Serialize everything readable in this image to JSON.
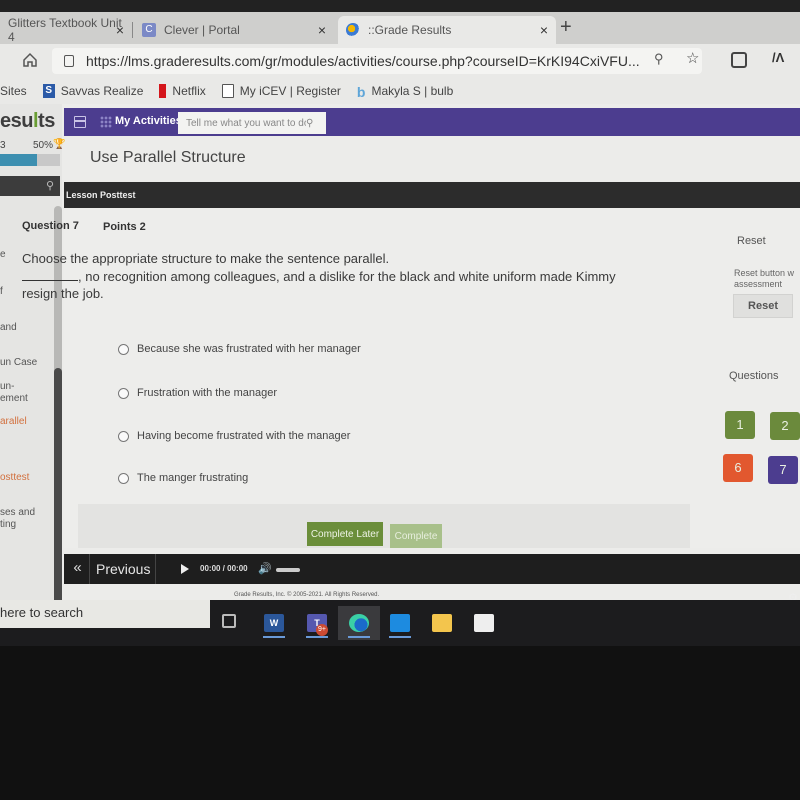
{
  "browser": {
    "tabs": [
      {
        "label": "Glitters Textbook Unit 4",
        "active": false
      },
      {
        "label": "Clever | Portal",
        "icon": "clever-icon",
        "active": false
      },
      {
        "label": "::Grade Results",
        "icon": "grade-results-icon",
        "active": true
      }
    ],
    "close_glyph": "×",
    "new_tab_glyph": "+",
    "url": "https://lms.graderesults.com/gr/modules/activities/course.php?courseID=KrKI94CxiVFU...",
    "bookmarks": [
      {
        "label": "Sites"
      },
      {
        "label": "Savvas Realize",
        "icon": "savvas-icon"
      },
      {
        "label": "Netflix",
        "icon": "netflix-icon"
      },
      {
        "label": "My iCEV | Register",
        "icon": "document-icon"
      },
      {
        "label": "Makyla S | bulb",
        "icon": "bulb-icon"
      }
    ]
  },
  "sidebar": {
    "logo_main": "esu",
    "logo_accent": "l",
    "logo_end": "ts",
    "progress_left": "3",
    "progress_percent": "50%",
    "progress_fraction": 0.62,
    "items": [
      {
        "label": "e",
        "active": false
      },
      {
        "label": "f",
        "active": false
      },
      {
        "label": "and",
        "active": false
      },
      {
        "label": "un Case",
        "active": false
      },
      {
        "label": "un-",
        "active": false
      },
      {
        "label": "ement",
        "active": false
      },
      {
        "label": "arallel",
        "active": true
      },
      {
        "label": "osttest",
        "active": true
      },
      {
        "label": "ses and",
        "active": false
      },
      {
        "label": "ting",
        "active": false
      }
    ]
  },
  "topnav": {
    "my_activities": "My Activities",
    "search_placeholder": "Tell me what you want to do"
  },
  "page": {
    "title": "Use Parallel Structure",
    "section": "Lesson Posttest"
  },
  "question": {
    "number_label": "Question 7",
    "points_label": "Points 2",
    "prompt": "Choose the appropriate structure to make the sentence parallel.",
    "sentence_rest": ", no recognition among colleagues, and a dislike for the black and white uniform made Kimmy resign the job.",
    "options": [
      "Because she was frustrated with her manager",
      "Frustration with the manager",
      "Having become frustrated with the manager",
      "The manger frustrating"
    ]
  },
  "right_panel": {
    "reset_heading": "Reset",
    "reset_note_line1": "Reset button w",
    "reset_note_line2": "assessment",
    "reset_button": "Reset",
    "questions_heading": "Questions",
    "question_buttons": [
      {
        "label": "1",
        "color": "#6b8a3c"
      },
      {
        "label": "2",
        "color": "#6b8a3c"
      },
      {
        "label": "6",
        "color": "#e2582f"
      },
      {
        "label": "7",
        "color": "#4c3d8f"
      }
    ]
  },
  "actions": {
    "complete_later": "Complete Later",
    "complete": "Complete"
  },
  "player": {
    "prev_glyph": "«",
    "previous": "Previous",
    "time": "00:00 / 00:00"
  },
  "footer": {
    "copyright": "Grade Results, Inc. © 2005-2021. All Rights Reserved."
  },
  "taskbar": {
    "search_text": "here to search",
    "teams_badge": "9+"
  }
}
